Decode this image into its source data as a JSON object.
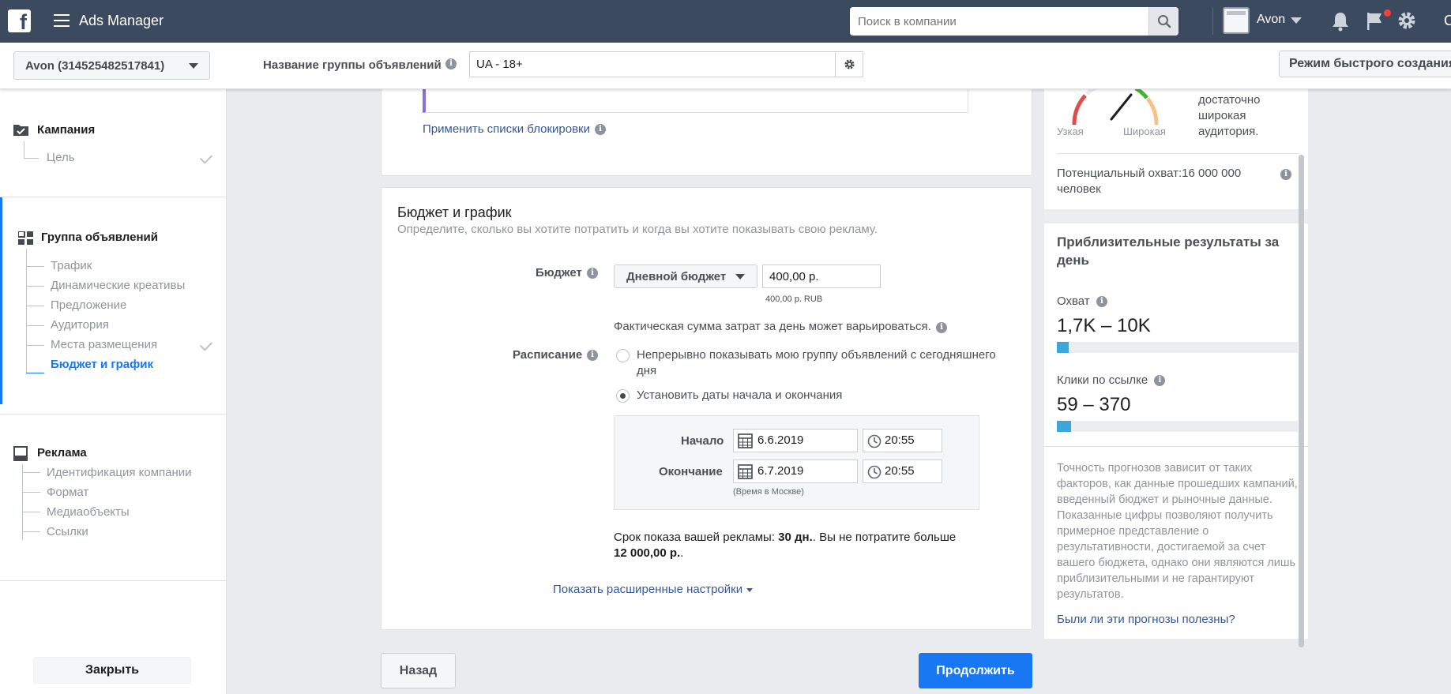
{
  "topbar": {
    "logo_letter": "f",
    "app_title": "Ads Manager",
    "search_placeholder": "Поиск в компании",
    "account_name": "Avon",
    "partial_edge_char": "C"
  },
  "subbar": {
    "account_select": "Avon (314525482517841)",
    "adset_name_label": "Название группы объявлений",
    "adset_name_value": "UA - 18+",
    "quick_mode_button": "Режим быстрого создания"
  },
  "sidebar": {
    "campaign": {
      "title": "Кампания",
      "items": [
        "Цель"
      ]
    },
    "adset": {
      "title": "Группа объявлений",
      "items": [
        "Трафик",
        "Динамические креативы",
        "Предложение",
        "Аудитория",
        "Места размещения",
        "Бюджет и график"
      ],
      "active_item": "Бюджет и график"
    },
    "ad": {
      "title": "Реклама",
      "items": [
        "Идентификация компании",
        "Формат",
        "Медиаобъекты",
        "Ссылки"
      ]
    },
    "close_button": "Закрыть"
  },
  "main": {
    "blocklist_link": "Применить списки блокировки",
    "budget": {
      "title": "Бюджет и график",
      "subtitle": "Определите, сколько вы хотите потратить и когда вы хотите показывать свою рекламу.",
      "budget_label": "Бюджет",
      "budget_type": "Дневной бюджет",
      "budget_value": "400,00 р.",
      "budget_note": "400,00 р. RUB",
      "variance_note": "Фактическая сумма затрат за день может варьироваться.",
      "schedule_label": "Расписание",
      "option_continuous": "Непрерывно показывать мою группу объявлений с сегодняшнего дня",
      "option_dates": "Установить даты начала и окончания",
      "start_label": "Начало",
      "start_date": "6.6.2019",
      "start_time": "20:55",
      "end_label": "Окончание",
      "end_date": "6.7.2019",
      "end_time": "20:55",
      "timezone_note": "(Время в Москве)",
      "summary_prefix": "Срок показа вашей рекламы: ",
      "summary_days": "30 дн.",
      "summary_mid": ". Вы не потратите больше",
      "summary_amount": "12 000,00 р.",
      "summary_suffix": ".",
      "advanced_link": "Показать расширенные настройки"
    },
    "back_button": "Назад",
    "continue_button": "Продолжить"
  },
  "right_panel": {
    "gauge_narrow": "Узкая",
    "gauge_wide": "Широкая",
    "gauge_desc_1": "достаточно",
    "gauge_desc_2": "широкая",
    "gauge_desc_3": "аудитория.",
    "potential_reach_label": "Потенциальный охват:",
    "potential_reach_value": "16 000 000",
    "potential_reach_unit": "человек",
    "estimates_title": "Приблизительные результаты за день",
    "reach_label": "Охват",
    "reach_value": "1,7K – 10K",
    "reach_fill": 0.05,
    "clicks_label": "Клики по ссылке",
    "clicks_value": "59 – 370",
    "clicks_fill": 0.06,
    "disclaimer": "Точность прогнозов зависит от таких факторов, как данные прошедших кампаний, введенный бюджет и рыночные данные. Показанные цифры позволяют получить примерное представление о результативности, достигаемой за счет вашего бюджета, однако они являются лишь приблизительными и не гарантируют результатов.",
    "feedback_link": "Были ли эти прогнозы полезны?"
  },
  "colors": {
    "topbar": "#3b4a5e",
    "primary": "#1877f2",
    "link": "#365899",
    "bar_fill": "#3fa6d9"
  }
}
